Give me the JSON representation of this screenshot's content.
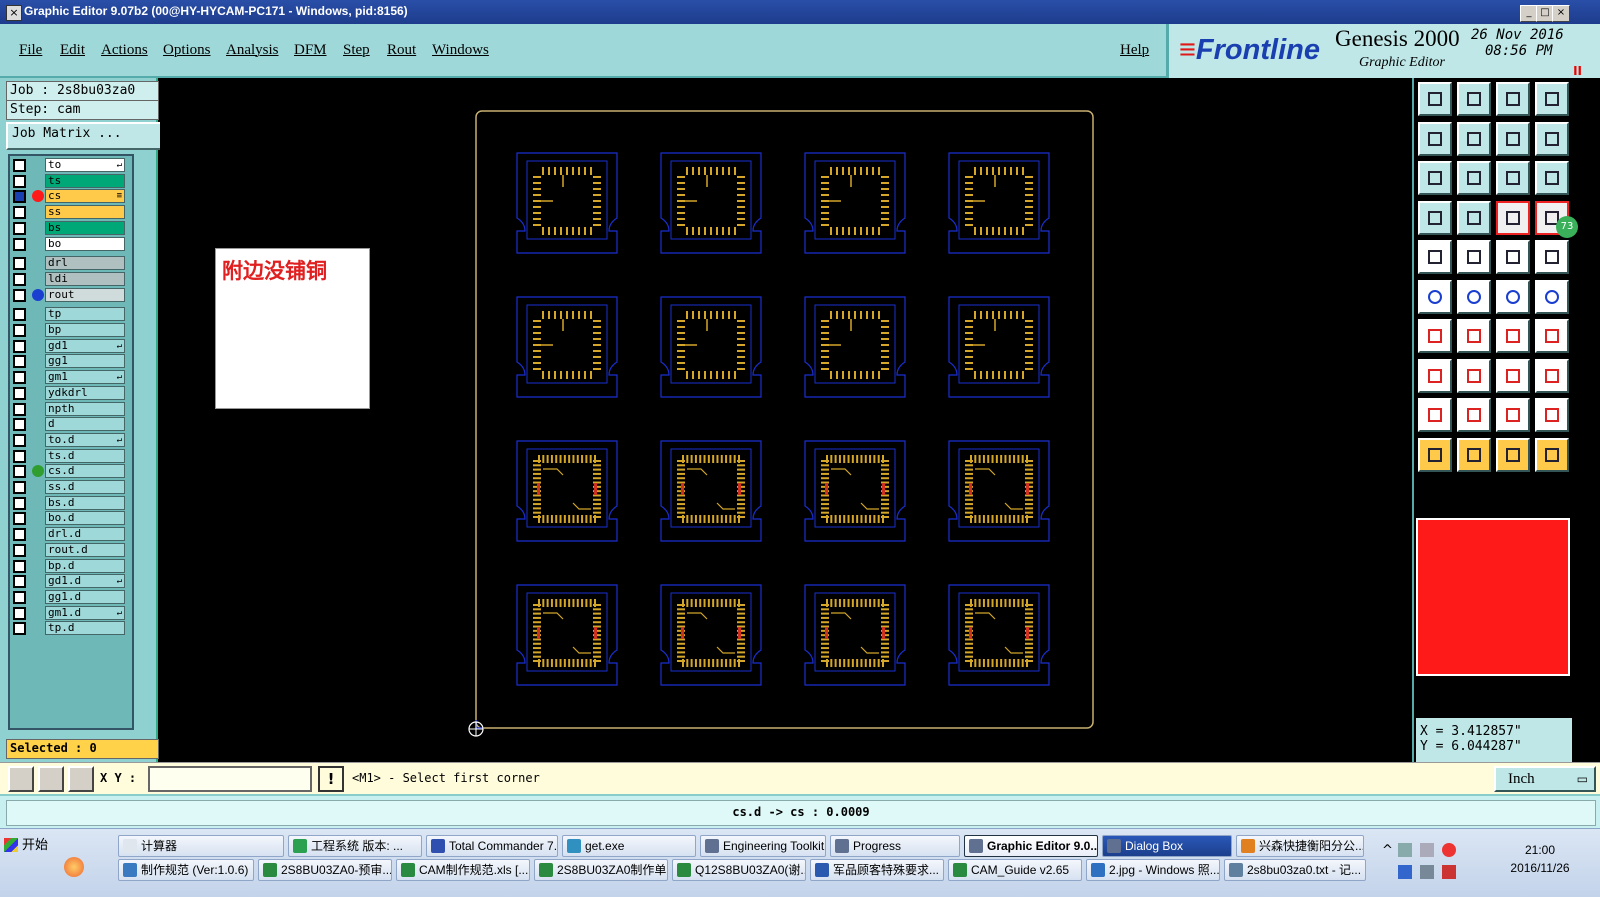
{
  "window": {
    "title": "Graphic Editor 9.07b2 (00@HY-HYCAM-PC171 - Windows, pid:8156)",
    "controls": [
      "_",
      "□",
      "×"
    ]
  },
  "menu": {
    "items": [
      "File",
      "Edit",
      "Actions",
      "Options",
      "Analysis",
      "DFM",
      "Step",
      "Rout",
      "Windows"
    ],
    "help": "Help"
  },
  "brand": {
    "logo": "Frontline",
    "product": "Genesis 2000",
    "subtitle": "Graphic Editor",
    "date": "26 Nov 2016",
    "time": "08:56 PM",
    "marker": "II"
  },
  "left": {
    "job": "Job : 2s8bu03za0",
    "step": "Step: cam",
    "job_matrix": "Job Matrix ...",
    "selected": "Selected : 0",
    "layers": [
      {
        "name": "to",
        "fill": "#ffffff",
        "checked": false,
        "dot": "",
        "mark": "↵"
      },
      {
        "name": "ts",
        "fill": "#00a878",
        "checked": false,
        "dot": "",
        "mark": ""
      },
      {
        "name": "cs",
        "fill": "#ffc94a",
        "checked": true,
        "dot": "#ff1a1a",
        "mark": "≡"
      },
      {
        "name": "ss",
        "fill": "#ffc94a",
        "checked": false,
        "dot": "",
        "mark": ""
      },
      {
        "name": "bs",
        "fill": "#00a878",
        "checked": false,
        "dot": "",
        "mark": ""
      },
      {
        "name": "bo",
        "fill": "#ffffff",
        "checked": false,
        "dot": "",
        "mark": ""
      },
      {
        "name": "drl",
        "fill": "#b0c0c0",
        "checked": false,
        "dot": "",
        "mark": ""
      },
      {
        "name": "ldi",
        "fill": "#b0c0c0",
        "checked": false,
        "dot": "",
        "mark": ""
      },
      {
        "name": "rout",
        "fill": "#d0dcdc",
        "checked": false,
        "dot": "#1a3fd0",
        "mark": ""
      },
      {
        "name": "tp",
        "fill": "#9fd8d8",
        "checked": false,
        "dot": "",
        "mark": ""
      },
      {
        "name": "bp",
        "fill": "#9fd8d8",
        "checked": false,
        "dot": "",
        "mark": ""
      },
      {
        "name": "gd1",
        "fill": "#9fd8d8",
        "checked": false,
        "dot": "",
        "mark": "↵"
      },
      {
        "name": "gg1",
        "fill": "#9fd8d8",
        "checked": false,
        "dot": "",
        "mark": ""
      },
      {
        "name": "gm1",
        "fill": "#9fd8d8",
        "checked": false,
        "dot": "",
        "mark": "↵"
      },
      {
        "name": "ydkdrl",
        "fill": "#9fd8d8",
        "checked": false,
        "dot": "",
        "mark": ""
      },
      {
        "name": "npth",
        "fill": "#9fd8d8",
        "checked": false,
        "dot": "",
        "mark": ""
      },
      {
        "name": "d",
        "fill": "#9fd8d8",
        "checked": false,
        "dot": "",
        "mark": ""
      },
      {
        "name": "to.d",
        "fill": "#9fd8d8",
        "checked": false,
        "dot": "",
        "mark": "↵"
      },
      {
        "name": "ts.d",
        "fill": "#9fd8d8",
        "checked": false,
        "dot": "",
        "mark": ""
      },
      {
        "name": "cs.d",
        "fill": "#9fd8d8",
        "checked": false,
        "dot": "#2f9e2f",
        "mark": ""
      },
      {
        "name": "ss.d",
        "fill": "#9fd8d8",
        "checked": false,
        "dot": "",
        "mark": ""
      },
      {
        "name": "bs.d",
        "fill": "#9fd8d8",
        "checked": false,
        "dot": "",
        "mark": ""
      },
      {
        "name": "bo.d",
        "fill": "#9fd8d8",
        "checked": false,
        "dot": "",
        "mark": ""
      },
      {
        "name": "drl.d",
        "fill": "#9fd8d8",
        "checked": false,
        "dot": "",
        "mark": ""
      },
      {
        "name": "rout.d",
        "fill": "#9fd8d8",
        "checked": false,
        "dot": "",
        "mark": ""
      },
      {
        "name": "bp.d",
        "fill": "#9fd8d8",
        "checked": false,
        "dot": "",
        "mark": ""
      },
      {
        "name": "gd1.d",
        "fill": "#9fd8d8",
        "checked": false,
        "dot": "",
        "mark": "↵"
      },
      {
        "name": "gg1.d",
        "fill": "#9fd8d8",
        "checked": false,
        "dot": "",
        "mark": ""
      },
      {
        "name": "gm1.d",
        "fill": "#9fd8d8",
        "checked": false,
        "dot": "",
        "mark": "↵"
      },
      {
        "name": "tp.d",
        "fill": "#9fd8d8",
        "checked": false,
        "dot": "",
        "mark": ""
      }
    ]
  },
  "canvas": {
    "note": "附边没铺铜",
    "panel_rows": 4,
    "panel_cols": 4,
    "colors": {
      "outline": "#1a2fd0",
      "pad": "#d4a62a",
      "panel_edge": "#c8b070",
      "accent": "#d03020",
      "note_text": "#e02020"
    }
  },
  "right": {
    "badge": "73",
    "coord_x": "X =  3.412857\"",
    "coord_y": "Y =  6.044287\"",
    "tools": [
      "open-step-icon",
      "close-step-icon",
      "home-icon",
      "window-icon",
      "snap-left-icon",
      "snap-right-icon",
      "zoom-fit-icon",
      "redraw-icon",
      "zoom-all-icon",
      "zoom-extents-icon",
      "one-to-one-icon",
      "help-icon",
      "measure-icon",
      "grid-icon",
      "connect-icon",
      "layers-icon",
      "pad-icon",
      "draw-shape-icon",
      "ruler-icon",
      "fill-circle-icon",
      "node-icon",
      "cross-icon",
      "line-dot-icon",
      "line-arrow-icon",
      "angle-icon",
      "slash-icon",
      "rotate-icon",
      "mirror-icon",
      "scale-icon",
      "minus-icon",
      "align-icon",
      "group-icon",
      "arc-left-icon",
      "arc-up-icon",
      "arc-down-icon",
      "arc-right-icon",
      "select-icon",
      "select-box-icon",
      "select-region-icon",
      "select-path-icon"
    ]
  },
  "command": {
    "xy_label": "X Y :",
    "xy_value": "",
    "bang": "!",
    "prompt": "<M1> - Select first corner",
    "unit": "Inch"
  },
  "status": {
    "text": "cs.d -> cs : 0.0009"
  },
  "taskbar": {
    "start": "开始",
    "row1": [
      {
        "label": "计算器",
        "color": "#dfe6ee"
      },
      {
        "label": "工程系统  版本: ...",
        "color": "#2aa050"
      },
      {
        "label": "Total Commander 7...",
        "color": "#3050b0"
      },
      {
        "label": "get.exe",
        "color": "#3090c0"
      },
      {
        "label": "Engineering Toolkit ...",
        "color": "#607090"
      },
      {
        "label": "Progress",
        "color": "#607090"
      },
      {
        "label": "Graphic Editor 9.0...",
        "color": "#607090"
      },
      {
        "label": "Dialog Box",
        "color": "#607090"
      },
      {
        "label": "兴森快捷衡阳分公...",
        "color": "#e08020"
      }
    ],
    "row2": [
      {
        "label": "制作规范 (Ver:1.0.6)",
        "color": "#3a7ac0"
      },
      {
        "label": "2S8BU03ZA0-预审...",
        "color": "#2a8a40"
      },
      {
        "label": "CAM制作规范.xls  [...",
        "color": "#2a8a40"
      },
      {
        "label": "2S8BU03ZA0制作单...",
        "color": "#2a8a40"
      },
      {
        "label": "Q12S8BU03ZA0(谢...",
        "color": "#2a8a40"
      },
      {
        "label": "军品顾客特殊要求...",
        "color": "#2a5ab0"
      },
      {
        "label": "CAM_Guide v2.65",
        "color": "#2a8a40"
      },
      {
        "label": "2.jpg - Windows 照...",
        "color": "#3070c0"
      },
      {
        "label": "2s8bu03za0.txt - 记...",
        "color": "#6080a0"
      }
    ],
    "time": "21:00",
    "date": "2016/11/26"
  }
}
